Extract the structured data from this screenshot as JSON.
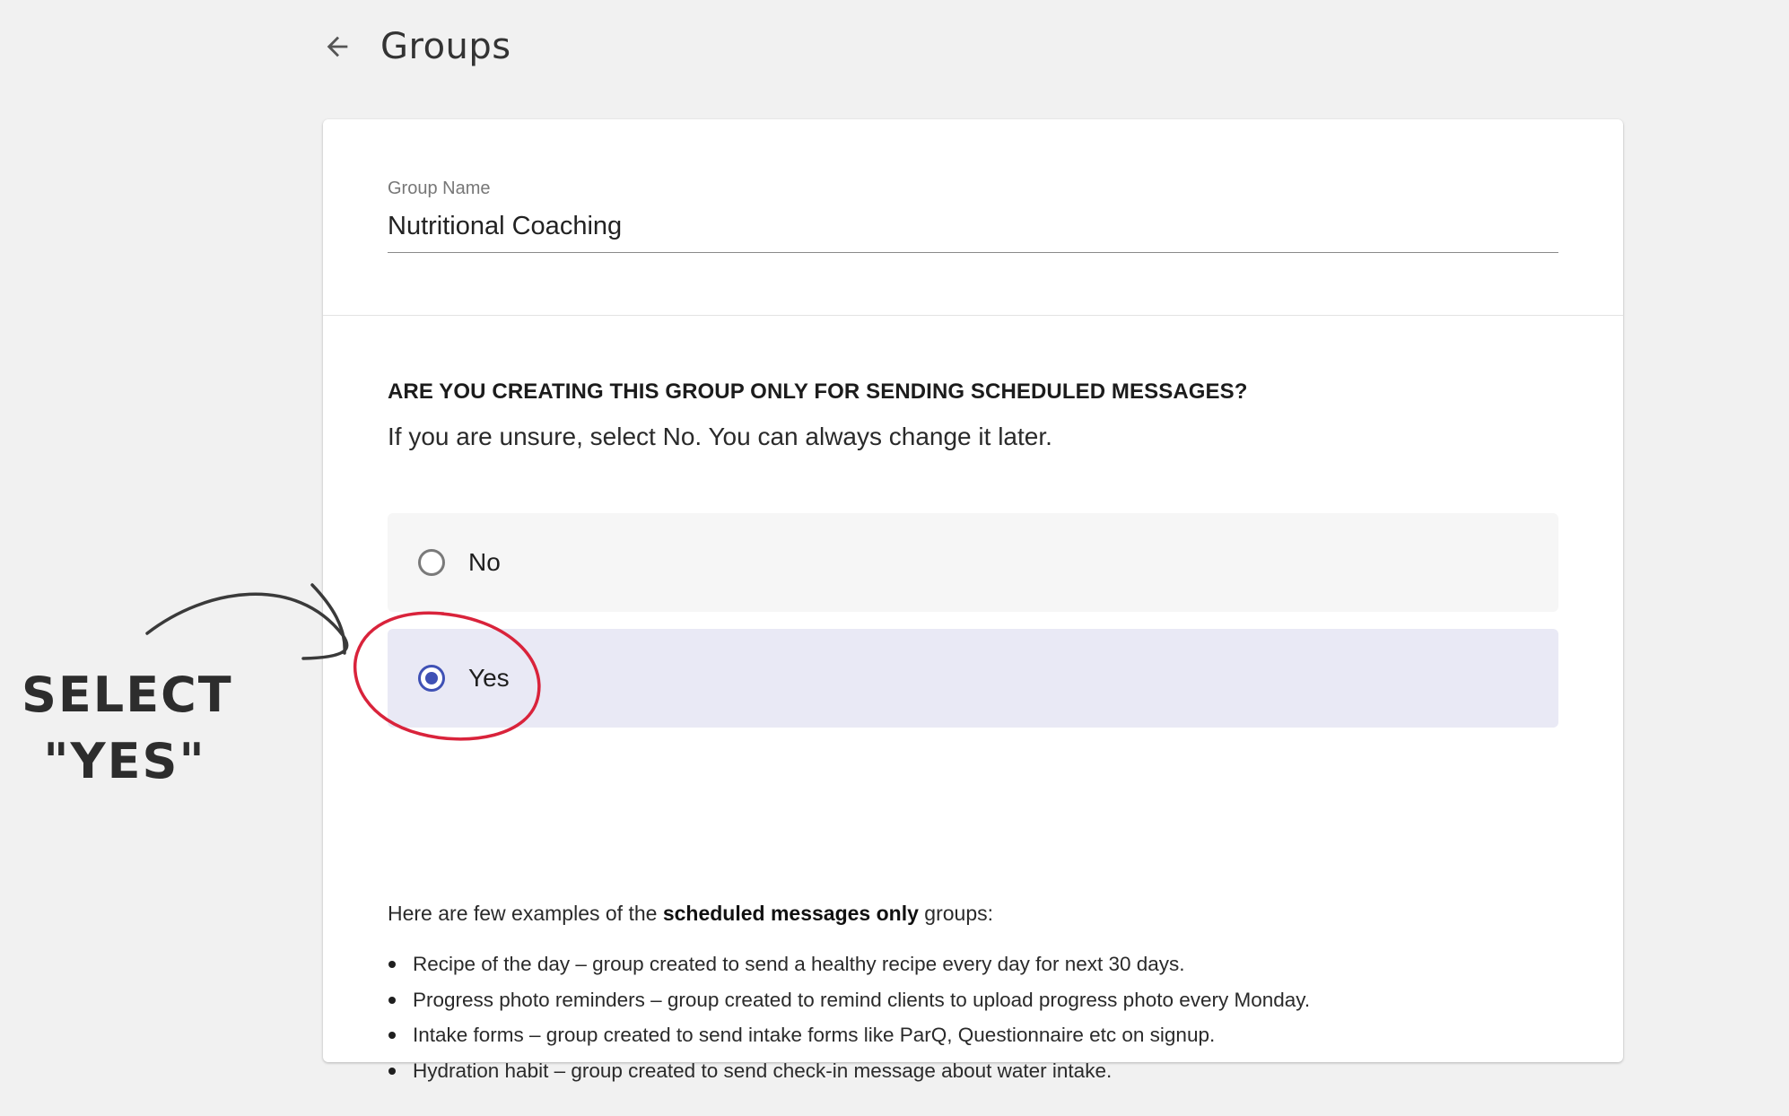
{
  "header": {
    "back_icon": "arrow-left-icon",
    "title": "Groups"
  },
  "group_name": {
    "label": "Group Name",
    "value": "Nutritional Coaching"
  },
  "schedule_question": {
    "title": "ARE YOU CREATING THIS GROUP ONLY FOR SENDING SCHEDULED MESSAGES?",
    "hint": "If you are unsure, select No. You can always change it later.",
    "options": [
      {
        "label": "No",
        "selected": false
      },
      {
        "label": "Yes",
        "selected": true
      }
    ]
  },
  "examples": {
    "intro_prefix": "Here are few examples of the ",
    "intro_bold": "scheduled messages only",
    "intro_suffix": " groups:",
    "items": [
      "Recipe of the day – group created to send a healthy recipe every day for next 30 days.",
      "Progress photo reminders – group created to remind clients to upload progress photo every Monday.",
      "Intake forms – group created to send intake forms like ParQ, Questionnaire etc on signup.",
      "Hydration habit – group created to send check-in message about water intake."
    ]
  },
  "annotation": {
    "line1": "SELECT",
    "line2": "\"YES\"",
    "circle_color": "#d9233b",
    "arrow_color": "#3a3a3a"
  },
  "colors": {
    "accent": "#3f51b5",
    "selected_bg": "#e9e9f5",
    "page_bg": "#f1f1f1"
  }
}
